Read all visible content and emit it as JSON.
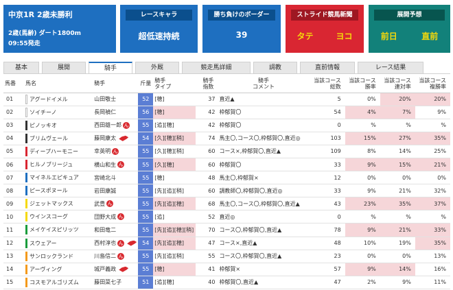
{
  "race": {
    "title": "中京1R  2歳未勝利",
    "conditions": "2歳(馬齢)  ダート1800m",
    "start_time": "09:55発走"
  },
  "race_chara": {
    "label": "レースキャラ",
    "value": "超低速持続"
  },
  "border": {
    "label": "勝ち負けのボーダー",
    "value": "39"
  },
  "stride": {
    "label": "ストライド競馬新聞",
    "left": "タテ",
    "right": "ヨコ"
  },
  "prediction": {
    "label": "展開予想",
    "left": "前日",
    "right": "直前"
  },
  "tabs": [
    {
      "label": "基本",
      "active": false
    },
    {
      "label": "展開",
      "active": false
    },
    {
      "label": "騎手",
      "active": true
    },
    {
      "label": "外厩",
      "active": false
    },
    {
      "label": "競走馬詳細",
      "active": false
    },
    {
      "label": "調教",
      "active": false
    },
    {
      "label": "直前情報",
      "active": false
    },
    {
      "label": "レース結果",
      "active": false
    }
  ],
  "table_headers": {
    "num": "馬番",
    "name": "馬名",
    "jockey": "騎手",
    "weight": "斤量",
    "type": "騎手\nタイプ",
    "index": "騎手\n指数",
    "comment": "騎手\nコメント",
    "runs": "当該コース\n総数",
    "win": "当該コース\n勝率",
    "place": "当該コース\n連対率",
    "show": "当該コース\n複勝率"
  },
  "colors": {
    "wakuban": [
      "#ffffff",
      "#ffffff",
      "#333333",
      "#333333",
      "#d92632",
      "#d92632",
      "#1e6fc0",
      "#1e6fc0",
      "#f5d90a",
      "#f5d90a",
      "#1a9c3c",
      "#1a9c3c",
      "#f39a1c",
      "#f39a1c",
      "#f39a1c"
    ],
    "highlight": "#f6d6d9",
    "weight_bg": "#5b7ed4"
  },
  "rows": [
    {
      "num": "01",
      "name": "アグードイメル",
      "jockey": "山田敬士",
      "mark": "",
      "horse_icon": false,
      "weight": "52",
      "type": "[穂]",
      "type_hl": false,
      "index": "37",
      "comment": "直近▲",
      "runs": "5",
      "win": "0%",
      "win_hl": false,
      "place": "20%",
      "place_hl": true,
      "show": "20%",
      "show_hl": true
    },
    {
      "num": "02",
      "name": "ソイチーノ",
      "jockey": "長岡禎仁",
      "mark": "",
      "horse_icon": false,
      "weight": "56",
      "type": "[穂]",
      "type_hl": true,
      "index": "42",
      "comment": "枠郁賀〇",
      "runs": "54",
      "win": "4%",
      "win_hl": true,
      "place": "7%",
      "place_hl": true,
      "show": "9%",
      "show_hl": false
    },
    {
      "num": "03",
      "name": "ピノッキオ",
      "jockey": "西田雄一郎",
      "mark": "ん",
      "horse_icon": false,
      "weight": "55",
      "type": "[追][穂]",
      "type_hl": false,
      "index": "42",
      "comment": "枠郁賀〇",
      "runs": "0",
      "win": "%",
      "win_hl": false,
      "place": "%",
      "place_hl": false,
      "show": "%",
      "show_hl": false
    },
    {
      "num": "04",
      "name": "ブリムヴェール",
      "jockey": "藤岡康太",
      "mark": "",
      "horse_icon": true,
      "weight": "54",
      "type": "[久][穂][稍]",
      "type_hl": true,
      "index": "74",
      "comment": "馬主〇,コース〇,枠郁賀〇,直近◎",
      "runs": "103",
      "win": "15%",
      "win_hl": true,
      "place": "27%",
      "place_hl": true,
      "show": "35%",
      "show_hl": true
    },
    {
      "num": "05",
      "name": "ディープハーモニー",
      "jockey": "幸英明",
      "mark": "ん",
      "horse_icon": false,
      "weight": "55",
      "type": "[久][穂][稍]",
      "type_hl": false,
      "index": "60",
      "comment": "コース×,枠郁賀〇,直近▲",
      "runs": "109",
      "win": "8%",
      "win_hl": false,
      "place": "14%",
      "place_hl": false,
      "show": "25%",
      "show_hl": false
    },
    {
      "num": "06",
      "name": "ヒルノブリージュ",
      "jockey": "横山和生",
      "mark": "ん",
      "horse_icon": false,
      "weight": "55",
      "type": "[久][穂]",
      "type_hl": true,
      "index": "60",
      "comment": "枠郁賀〇",
      "runs": "33",
      "win": "9%",
      "win_hl": true,
      "place": "15%",
      "place_hl": true,
      "show": "21%",
      "show_hl": true
    },
    {
      "num": "07",
      "name": "マイネルエピキュア",
      "jockey": "宮崎北斗",
      "mark": "",
      "horse_icon": false,
      "weight": "55",
      "type": "[穂]",
      "type_hl": false,
      "index": "48",
      "comment": "馬主〇,枠郁賀×",
      "runs": "12",
      "win": "0%",
      "win_hl": false,
      "place": "0%",
      "place_hl": false,
      "show": "0%",
      "show_hl": false
    },
    {
      "num": "08",
      "name": "ピースポヌール",
      "jockey": "岩田康誠",
      "mark": "",
      "horse_icon": false,
      "weight": "55",
      "type": "[先][追][稍]",
      "type_hl": false,
      "index": "60",
      "comment": "調教師〇,枠郁賀〇,直近◎",
      "runs": "33",
      "win": "9%",
      "win_hl": false,
      "place": "21%",
      "place_hl": false,
      "show": "32%",
      "show_hl": false
    },
    {
      "num": "09",
      "name": "ジェットマックス",
      "jockey": "武豊",
      "mark": "ん",
      "horse_icon": false,
      "weight": "55",
      "type": "[先][追][穂]",
      "type_hl": true,
      "index": "68",
      "comment": "馬主〇,コース〇,枠郁賀〇,直近▲",
      "runs": "43",
      "win": "23%",
      "win_hl": true,
      "place": "35%",
      "place_hl": true,
      "show": "37%",
      "show_hl": true
    },
    {
      "num": "10",
      "name": "ウインスコーグ",
      "jockey": "団野大成",
      "mark": "ん",
      "horse_icon": false,
      "weight": "55",
      "type": "[追]",
      "type_hl": false,
      "index": "52",
      "comment": "直近◎",
      "runs": "0",
      "win": "%",
      "win_hl": false,
      "place": "%",
      "place_hl": false,
      "show": "%",
      "show_hl": false
    },
    {
      "num": "11",
      "name": "メイケイスピリッツ",
      "jockey": "和田竜二",
      "mark": "",
      "horse_icon": false,
      "weight": "55",
      "type": "[先][追][穂][稍]",
      "type_hl": true,
      "index": "70",
      "comment": "コース〇,枠郁賀〇,直近▲",
      "runs": "78",
      "win": "9%",
      "win_hl": true,
      "place": "21%",
      "place_hl": true,
      "show": "33%",
      "show_hl": true
    },
    {
      "num": "12",
      "name": "スウェアー",
      "jockey": "西村淳也",
      "mark": "ん",
      "horse_icon": true,
      "weight": "54",
      "type": "[先][追][穂]",
      "type_hl": true,
      "index": "47",
      "comment": "コース×,直近▲",
      "runs": "48",
      "win": "10%",
      "win_hl": false,
      "place": "19%",
      "place_hl": false,
      "show": "35%",
      "show_hl": true
    },
    {
      "num": "13",
      "name": "サンロックランド",
      "jockey": "川島信二",
      "mark": "ん",
      "horse_icon": false,
      "weight": "55",
      "type": "[先][追][稍]",
      "type_hl": false,
      "index": "55",
      "comment": "コース〇,枠郁賀〇,直近▲",
      "runs": "23",
      "win": "0%",
      "win_hl": false,
      "place": "0%",
      "place_hl": false,
      "show": "13%",
      "show_hl": false
    },
    {
      "num": "14",
      "name": "アーヴィング",
      "jockey": "城戸義政",
      "mark": "",
      "horse_icon": true,
      "weight": "55",
      "type": "[穂]",
      "type_hl": true,
      "index": "41",
      "comment": "枠郁賀×",
      "runs": "57",
      "win": "9%",
      "win_hl": true,
      "place": "14%",
      "place_hl": true,
      "show": "16%",
      "show_hl": false
    },
    {
      "num": "15",
      "name": "コスモアルゴリズム",
      "jockey": "藤田菜七子",
      "mark": "",
      "horse_icon": false,
      "weight": "51",
      "type": "[追][穂]",
      "type_hl": false,
      "index": "40",
      "comment": "枠郁賀〇,直近▲",
      "runs": "47",
      "win": "2%",
      "win_hl": false,
      "place": "9%",
      "place_hl": false,
      "show": "11%",
      "show_hl": false
    }
  ]
}
